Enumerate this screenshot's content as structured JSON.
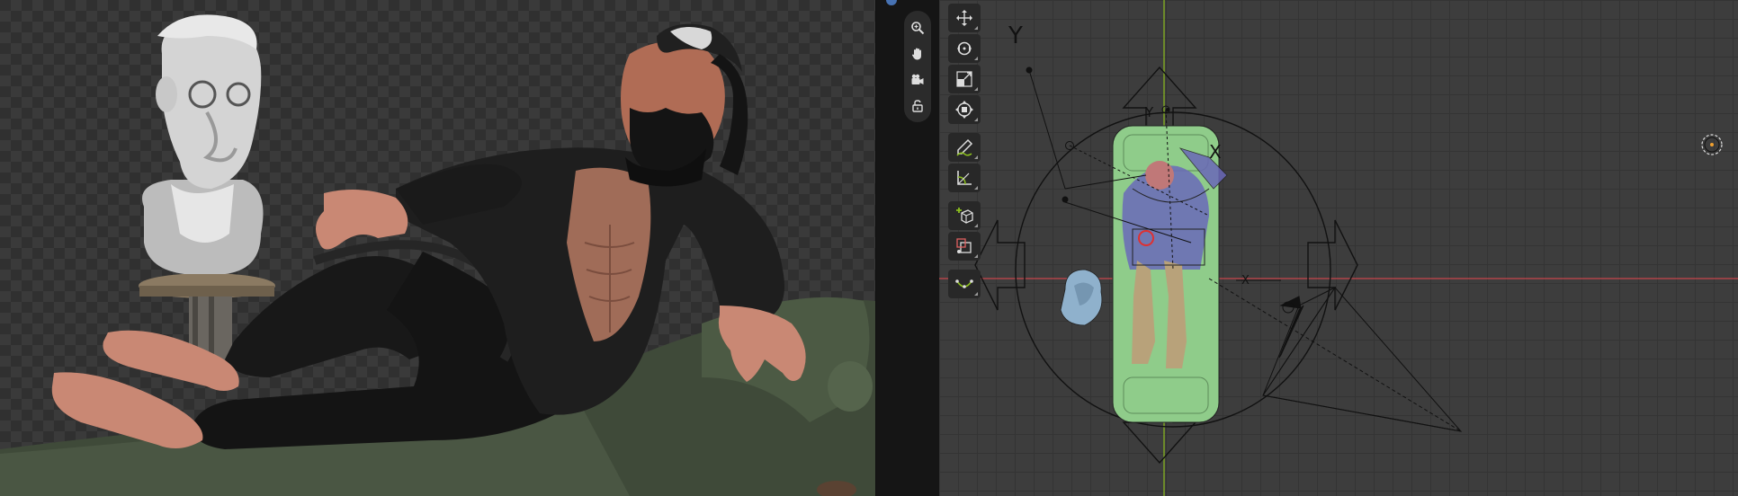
{
  "viewport_left": {
    "description_icons": [
      "render-image"
    ]
  },
  "navigation_gizmo": {
    "buttons": [
      {
        "name": "zoom-icon",
        "glyph": "🔍"
      },
      {
        "name": "pan-hand-icon",
        "glyph": "✋"
      },
      {
        "name": "camera-icon",
        "glyph": "🎥"
      },
      {
        "name": "lock-icon",
        "glyph": "🔓"
      }
    ]
  },
  "toolbar": {
    "groups": [
      [
        "move-icon",
        "rotate-icon",
        "scale-icon",
        "transform-icon"
      ],
      [
        "annotate-icon",
        "measure-icon"
      ],
      [
        "add-cube-icon",
        "extrude-icon"
      ],
      [
        "curve-icon"
      ]
    ]
  },
  "scene": {
    "axis_label_top_left": "Y",
    "axis_label_gizmo_y": "Y",
    "axis_label_gizmo_x": "X",
    "axis_label_small_x": "X",
    "colors": {
      "x_axis": "#c8464b",
      "y_axis": "#8bbe1e",
      "couch": "#8fcc8a",
      "shirt": "#6a68b8",
      "skin": "#b8a27a",
      "bust": "#8fb1cc"
    }
  }
}
